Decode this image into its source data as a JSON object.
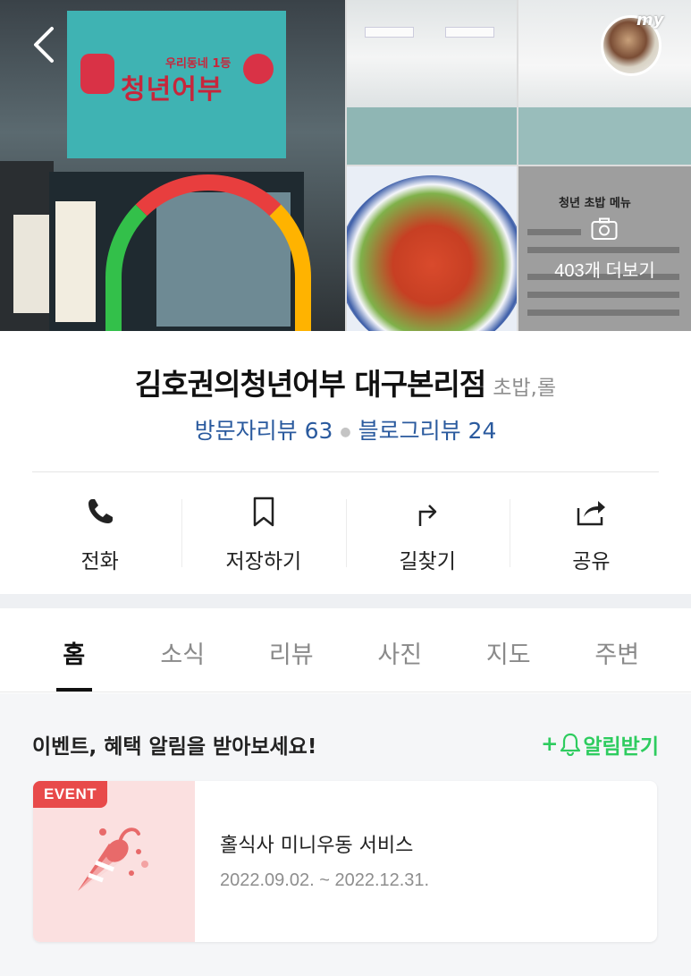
{
  "header": {
    "back_icon": "chevron-left-icon",
    "profile_label": "my",
    "photo_more_label": "403개 더보기",
    "sign_text": "청년어부",
    "sign_sub": "우리동네 1등",
    "menu_title": "청년 초밥 메뉴"
  },
  "place": {
    "name": "김호권의청년어부 대구본리점",
    "category": "초밥,롤",
    "visitor_reviews": "방문자리뷰 63",
    "blog_reviews": "블로그리뷰 24"
  },
  "actions": [
    {
      "label": "전화",
      "icon": "phone-icon"
    },
    {
      "label": "저장하기",
      "icon": "bookmark-icon"
    },
    {
      "label": "길찾기",
      "icon": "directions-icon"
    },
    {
      "label": "공유",
      "icon": "share-icon"
    }
  ],
  "tabs": [
    {
      "label": "홈",
      "active": true
    },
    {
      "label": "소식",
      "active": false
    },
    {
      "label": "리뷰",
      "active": false
    },
    {
      "label": "사진",
      "active": false
    },
    {
      "label": "지도",
      "active": false
    },
    {
      "label": "주변",
      "active": false
    }
  ],
  "event_section": {
    "title": "이벤트, 혜택 알림을 받아보세요!",
    "notify_plus": "+",
    "notify_label": "알림받기",
    "card": {
      "badge": "EVENT",
      "title": "홀식사 미니우동 서비스",
      "date": "2022.09.02. ~ 2022.12.31."
    }
  },
  "colors": {
    "link_blue": "#2a5a9e",
    "notify_green": "#2ecc5f",
    "event_red": "#e84a4a"
  }
}
